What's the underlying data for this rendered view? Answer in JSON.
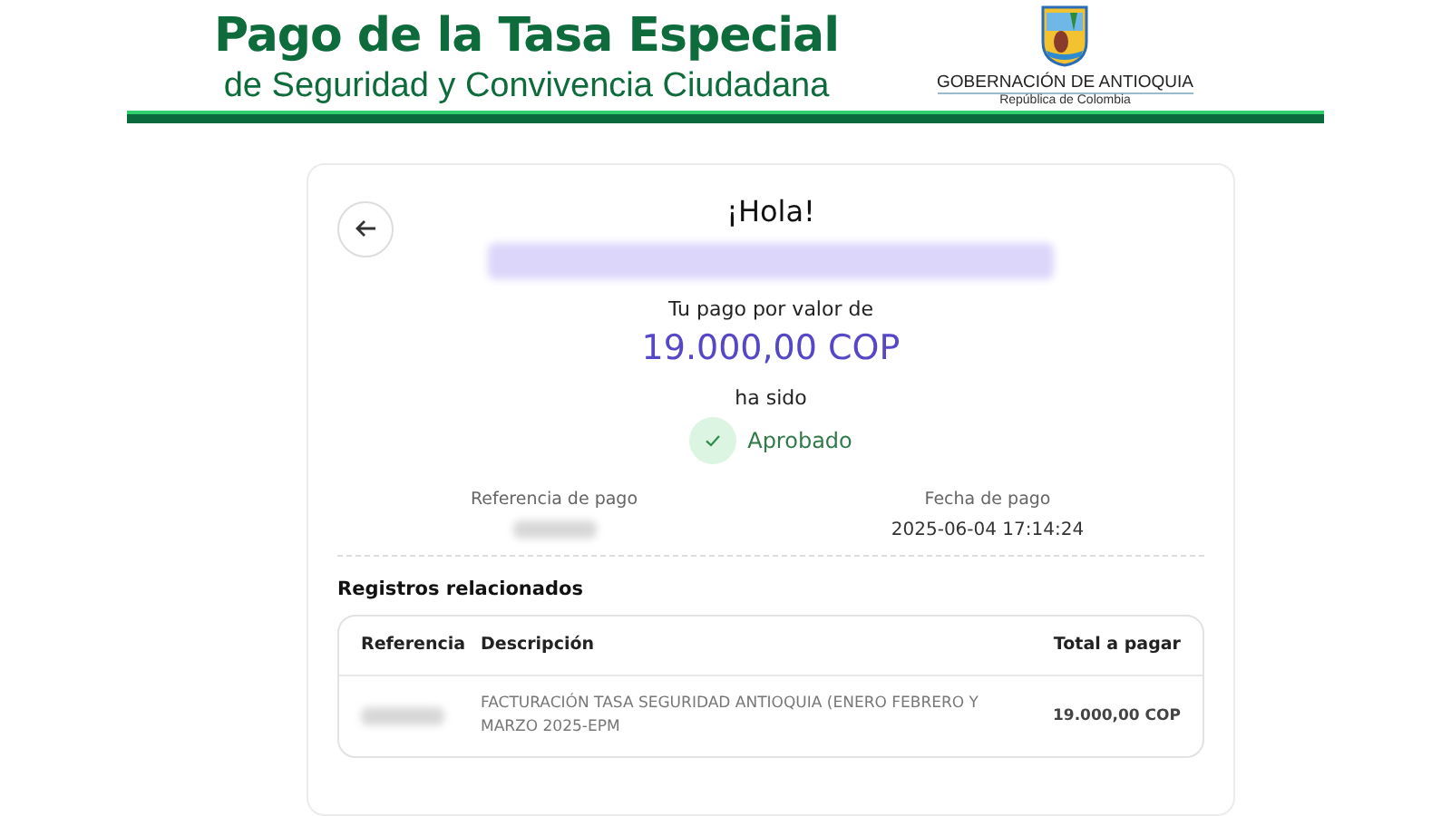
{
  "header": {
    "title": "Pago de la Tasa Especial",
    "subtitle": "de Seguridad y Convivencia Ciudadana",
    "logo_name": "GOBERNACIÓN DE ANTIOQUIA",
    "logo_country": "República de Colombia"
  },
  "card": {
    "greeting": "¡Hola!",
    "intro": "Tu pago por valor de",
    "amount": "19.000,00 COP",
    "outro": "ha sido",
    "status": {
      "label": "Aprobado",
      "approved": true
    },
    "details": [
      {
        "label": "Referencia de pago"
      },
      {
        "label": "Fecha de pago",
        "value": "2025-06-04 17:14:24"
      }
    ],
    "records_title": "Registros relacionados",
    "table": {
      "columns": [
        "Referencia",
        "Descripción",
        "Total a pagar"
      ],
      "rows": [
        {
          "description": "FACTURACIÓN TASA SEGURIDAD ANTIOQUIA (ENERO FEBRERO Y MARZO 2025-EPM",
          "total": "19.000,00 COP"
        }
      ]
    }
  }
}
